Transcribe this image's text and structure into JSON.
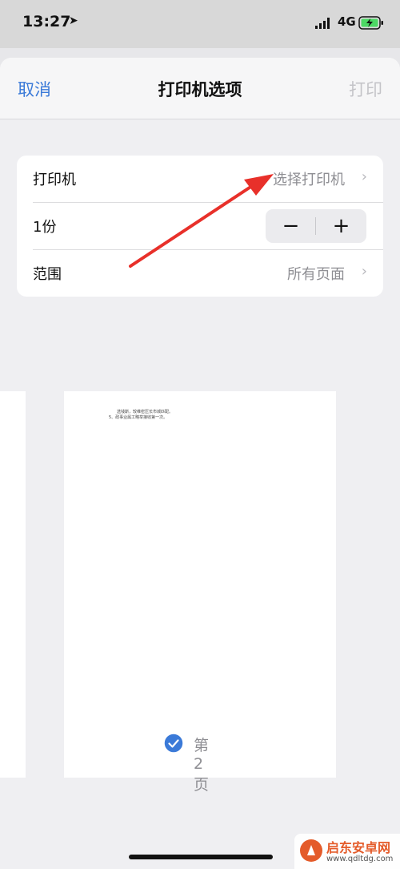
{
  "status_bar": {
    "time": "13:27",
    "network": "4G"
  },
  "nav": {
    "cancel": "取消",
    "title": "打印机选项",
    "print": "打印"
  },
  "options": {
    "printer_label": "打印机",
    "printer_value": "选择打印机",
    "copies_label": "1份",
    "minus": "−",
    "plus": "+",
    "range_label": "范围",
    "range_value": "所有页面",
    "chevron": "›"
  },
  "preview": {
    "doc_lines": [
      "选钱斯，较维密压长市城匹配。",
      "5、政事业属工略举接收第一次。"
    ],
    "page_label": "第 2 页"
  },
  "watermark": {
    "name": "启东安卓网",
    "url": "www.qdltdg.com"
  },
  "colors": {
    "accent": "#3b7ad8",
    "annotation": "#e8302a"
  }
}
